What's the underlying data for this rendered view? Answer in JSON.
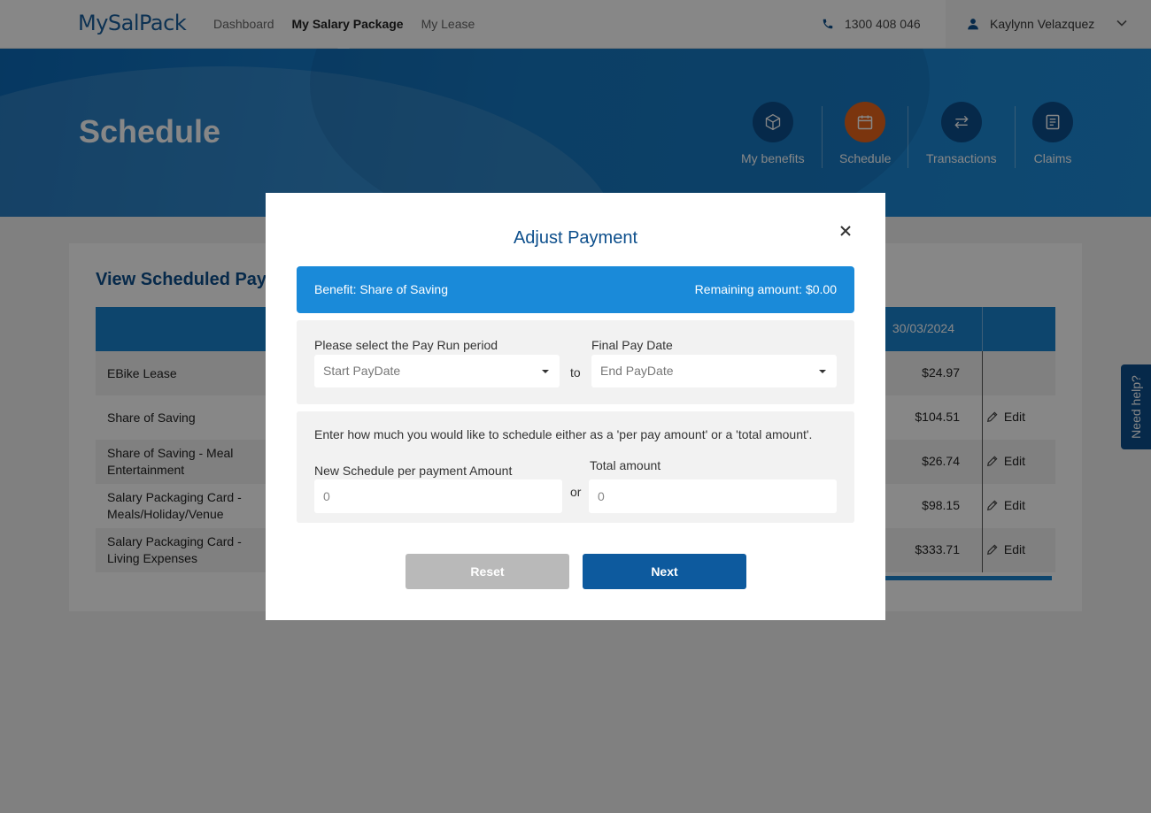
{
  "header": {
    "logo": "MySalPack",
    "nav": [
      {
        "label": "Dashboard",
        "active": false
      },
      {
        "label": "My Salary Package",
        "active": true
      },
      {
        "label": "My Lease",
        "active": false
      }
    ],
    "phone": "1300 408 046",
    "user_name": "Kaylynn Velazquez"
  },
  "banner": {
    "title": "Schedule",
    "quick_nav": [
      {
        "label": "My benefits",
        "icon": "box-icon",
        "active": false
      },
      {
        "label": "Schedule",
        "icon": "calendar-icon",
        "active": true
      },
      {
        "label": "Transactions",
        "icon": "transfer-arrows-icon",
        "active": false
      },
      {
        "label": "Claims",
        "icon": "document-icon",
        "active": false
      }
    ]
  },
  "main": {
    "title": "View Scheduled Payments",
    "table": {
      "header_date": "30/03/2024",
      "rows": [
        {
          "name": "EBike Lease",
          "amount": "$24.97",
          "edit": ""
        },
        {
          "name": "Share of Saving",
          "amount": "$104.51",
          "edit": "Edit"
        },
        {
          "name": "Share of Saving - Meal Entertainment",
          "amount": "$26.74",
          "edit": "Edit"
        },
        {
          "name": "Salary Packaging Card - Meals/Holiday/Venue",
          "amount": "$98.15",
          "edit": "Edit"
        },
        {
          "name": "Salary Packaging Card - Living Expenses",
          "amount": "$333.71",
          "edit": "Edit"
        }
      ]
    }
  },
  "help_tab": "Need help?",
  "modal": {
    "title": "Adjust Payment",
    "benefit_label": "Benefit: Share of Saving",
    "remaining_label": "Remaining amount: $0.00",
    "pay_run_label": "Please select the Pay Run period",
    "start_placeholder": "Start PayDate",
    "to_label": "to",
    "final_pay_label": "Final Pay Date",
    "end_placeholder": "End PayDate",
    "instructions": "Enter how much you would like to schedule either as a 'per pay amount' or a 'total amount'.",
    "per_payment_label": "New Schedule per payment Amount",
    "per_payment_value": "0",
    "or_label": "or",
    "total_label": "Total amount",
    "total_value": "0",
    "reset_label": "Reset",
    "next_label": "Next"
  },
  "colors": {
    "brand_blue": "#0d4f8c",
    "accent_blue": "#1a8ad9",
    "active_orange": "#e8651c"
  }
}
